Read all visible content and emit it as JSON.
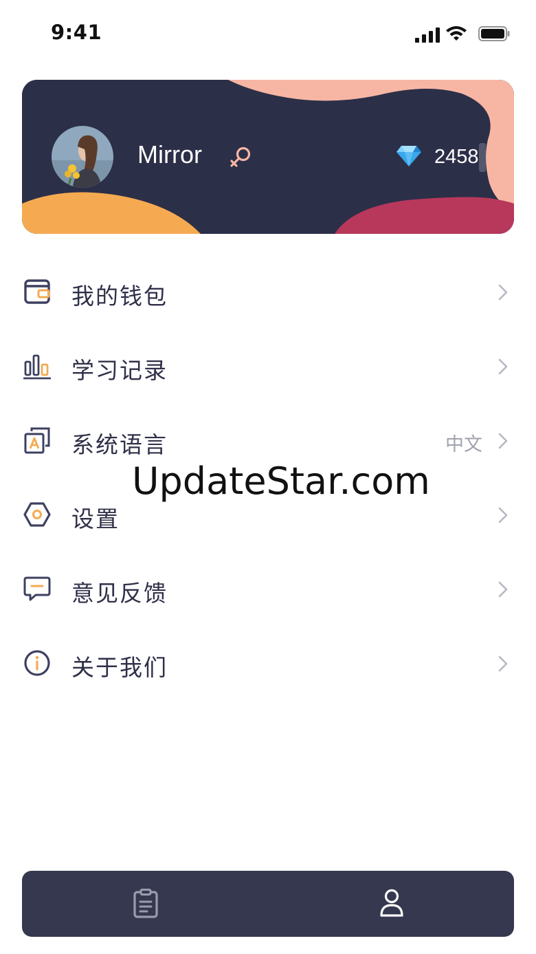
{
  "status_bar": {
    "time": "9:41"
  },
  "profile": {
    "username": "Mirror",
    "gender_icon": "female-symbol-icon",
    "diamond_icon": "diamond-icon",
    "diamonds": "2458"
  },
  "menu": {
    "items": [
      {
        "label": "我的钱包",
        "icon": "wallet-icon",
        "value": ""
      },
      {
        "label": "学习记录",
        "icon": "bar-chart-icon",
        "value": ""
      },
      {
        "label": "系统语言",
        "icon": "language-icon",
        "value": "中文"
      },
      {
        "label": "设置",
        "icon": "settings-hex-icon",
        "value": ""
      },
      {
        "label": "意见反馈",
        "icon": "feedback-icon",
        "value": ""
      },
      {
        "label": "关于我们",
        "icon": "info-icon",
        "value": ""
      }
    ]
  },
  "watermark": "UpdateStar.com",
  "tab_bar": {
    "tabs": [
      {
        "icon": "clipboard-icon",
        "active": false
      },
      {
        "icon": "user-icon",
        "active": true
      }
    ]
  },
  "colors": {
    "card_bg": "#2c2f48",
    "accent_orange": "#f5aa52",
    "accent_pink": "#f7b6a4",
    "accent_crimson": "#b8385c",
    "tab_bar_bg": "#36384f",
    "text_dark": "#2f3048",
    "text_muted": "#a0a2ad"
  }
}
